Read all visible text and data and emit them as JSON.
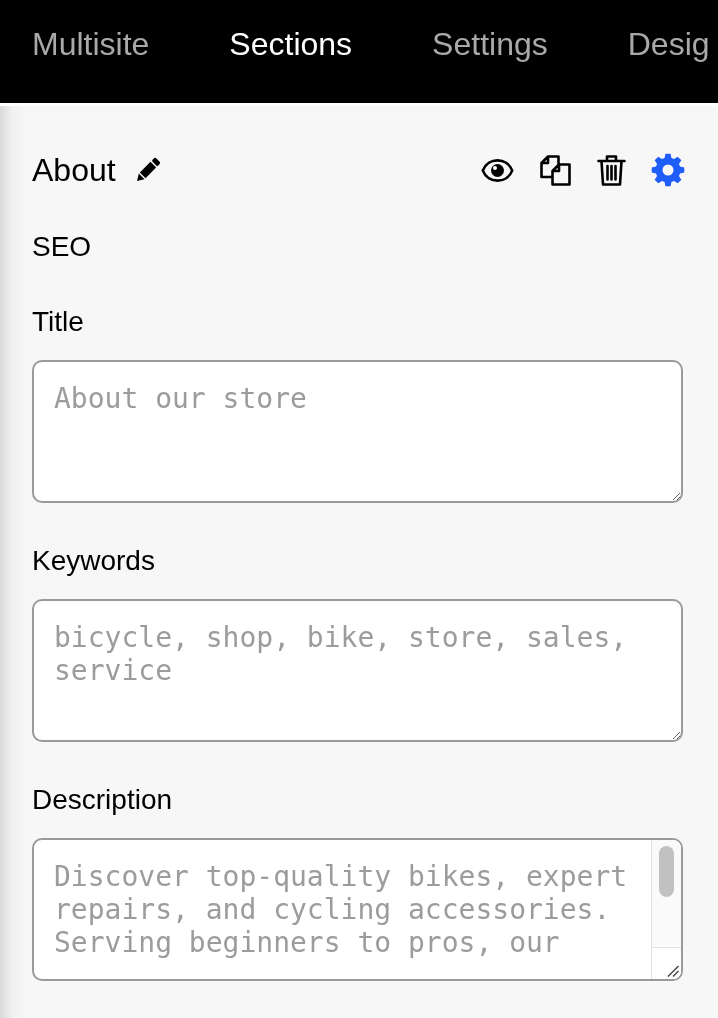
{
  "tabs": [
    {
      "label": "Multisite",
      "selected": false
    },
    {
      "label": "Sections",
      "selected": true
    },
    {
      "label": "Settings",
      "selected": false
    },
    {
      "label": "Desig",
      "selected": false
    }
  ],
  "section": {
    "title": "About",
    "actions": [
      {
        "kind": "preview",
        "selected": false
      },
      {
        "kind": "duplicate",
        "selected": false
      },
      {
        "kind": "delete",
        "selected": false
      },
      {
        "kind": "settings",
        "selected": true
      }
    ],
    "subheading": "SEO",
    "fields": [
      {
        "kind": "plain",
        "label": "Title",
        "placeholder": "About our store"
      },
      {
        "kind": "plain",
        "label": "Keywords",
        "placeholder": "bicycle, shop, bike, store, sales, service"
      },
      {
        "kind": "scrolling",
        "label": "Description",
        "placeholder": "Discover top-quality bikes, expert repairs, and cycling accessories. Serving beginners to pros, our"
      }
    ]
  }
}
